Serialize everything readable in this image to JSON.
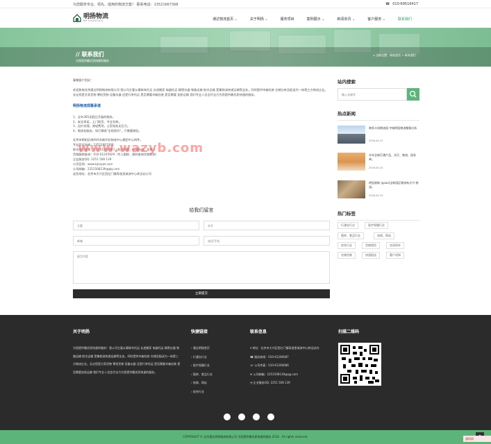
{
  "topbar": {
    "left": "为您服务专业、领先、成用的物流方案！ 联系电话：13521667368",
    "right_phone": "010-69516417"
  },
  "logo": {
    "name": "明扬物流",
    "sub": "MY LOGISTICS"
  },
  "nav": [
    {
      "label": "通达物流首页 ⌄"
    },
    {
      "label": "关于明扬 ⌄"
    },
    {
      "label": "服务项目"
    },
    {
      "label": "案例展示 ⌄"
    },
    {
      "label": "新闻资讯 ⌄"
    },
    {
      "label": "客户服务 ⌄"
    },
    {
      "label": "联系我们"
    }
  ],
  "banner": {
    "title": "// 联系我们",
    "subtitle": "为您提供最优质快捷的服务",
    "crumb": "⌂ 当前位置：网站首页 > 联系我们"
  },
  "content": {
    "greet": "尊敬客户您好：",
    "intro": "欢迎致电北京通达明扬物流有限公司 我公司主要从事联车托运 长途搬家 电器托运 精密仪器 铁路运输 航空运输 是集物流快递运输等业务。同时提供木箱包装 仓储分拣及配送为一体第三方物流企业。无论您是大家货物 零担货物 设备仪器 还是行李托运 是否需要木箱包装 是否需要 加急运输 我们专业人员会尽全力为您提供最优质快速的服务。",
    "subtitle": "明扬物流郑重承诺",
    "items": [
      "1、全年365无假日开展的服务。",
      "2、安全承诺，上门取货、专业包装。",
      "3、运价合理，减轻费用，让您轻松无压力。",
      "4、物流化服务，如打摘保\"全程保价\"，只需要微信。"
    ],
    "contact_lines": [
      "北京市朝阳区南四环东路华北物流中心建团中心附件。",
      "专业货运咨询：13521667368",
      "联合部开发票：010-61206687（机打发票、办理物流、发票。）",
      "货物跟踪查询：010-61245929（专人跟踪，随时查询货物状态）",
      "企业服务QQ: 2251 508 139",
      "公司官网：www.bjmywl.com",
      "公司邮箱：2251508139@qq.com",
      "送货地址：北京市大兴区西红门镇寿逸里城流中心转运站公司"
    ]
  },
  "watermark": "www.wazyb.com",
  "form": {
    "title": "给我们留言",
    "topic": "主题",
    "name": "名字",
    "email": "邮箱",
    "phone": "电话/手机",
    "message": "留言内容",
    "submit": "立即提交"
  },
  "sidebar": {
    "search_title": "站内搜索",
    "search_placeholder": "输入关键字",
    "hot_title": "热点新闻",
    "news": [
      {
        "title": "跨多卡如物流园 中城明园物流都服分析",
        "date": "2016-04-15"
      },
      {
        "title": "丰年全新打通产品、文打、物流、园非单。",
        "date": "2016-04-15"
      },
      {
        "title": "明显收取 (gaaa)全新园区物流有大兴 物流。",
        "date": "2016-04-15"
      }
    ],
    "tags_title": "热门标签",
    "tags": [
      "行通仓行业",
      "医疗保健行业",
      "图库、食品行业",
      "电商、网站",
      "综合行业",
      "货物保险",
      "合同同年",
      "仓储包装",
      "快速配送",
      "客户须知"
    ]
  },
  "footer": {
    "about_title": "关于明扬",
    "about_text": "为您提供最优质快速的服务！我公司主要从事联车托运 长途搬家 电器托运 精密仪器 铁路运输 航空运输 是集物流快递运输等业务。同时提供木箱包装 仓储及配送为一体第三方物流企业。无论您是大家货物 零担货物 设备仪器 还是行李托运 是否需要木箱包装 是否需要加急运输 我们专业人员会尽全力为您提供最优质快速的服务。",
    "links_title": "快捷链接",
    "links": [
      "通达明扬首页",
      "行通仓行业",
      "医疗保健行业",
      "图库、食品行业",
      "电商、网店",
      "综合行业"
    ],
    "contact_title": "联系信息",
    "contact": [
      "地址：北京市大兴区西红门镇寿逸里城流中心转运站内",
      "服务热线：010-61206687",
      "公司传真：010-61206686",
      "公司邮箱：2251508139@qq.com",
      "企业服务QQ: 2251 508 139"
    ],
    "qr_title": "扫描二维码",
    "copyright": "COPYRIGHT © 北京通达明扬物流有限公司 为您提供最优质快速的服务 2016 . All rights reserved.",
    "badge": "源码网"
  },
  "colors": {
    "accent": "#5cb47a",
    "footer_bg": "#2b2b2b"
  }
}
